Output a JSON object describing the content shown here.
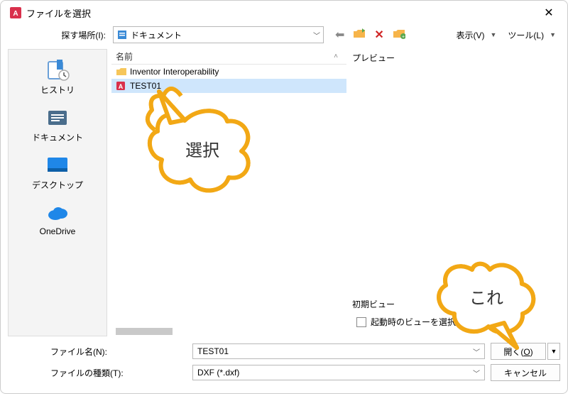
{
  "title": "ファイルを選択",
  "lookin": {
    "label": "探す場所(I):",
    "value": "ドキュメント"
  },
  "toolbar": {
    "view_label": "表示(V)",
    "tools_label": "ツール(L)"
  },
  "places": [
    {
      "label": "ヒストリ",
      "icon": "history"
    },
    {
      "label": "ドキュメント",
      "icon": "documents"
    },
    {
      "label": "デスクトップ",
      "icon": "desktop"
    },
    {
      "label": "OneDrive",
      "icon": "onedrive"
    }
  ],
  "list": {
    "col_name": "名前",
    "items": [
      {
        "name": "Inventor Interoperability",
        "type": "folder",
        "selected": false
      },
      {
        "name": "TEST01",
        "type": "autocad",
        "selected": true
      }
    ]
  },
  "preview": {
    "label": "プレビュー",
    "initview_label": "初期ビュー",
    "checkbox_label": "起動時のビューを選択する(E)",
    "checked": false
  },
  "bottom": {
    "filename_label": "ファイル名(N):",
    "filename_value": "TEST01",
    "filetype_label": "ファイルの種類(T):",
    "filetype_value": "DXF (*.dxf)",
    "open_label": "開く(O)",
    "cancel_label": "キャンセル"
  },
  "callouts": {
    "select": "選択",
    "this": "これ"
  }
}
